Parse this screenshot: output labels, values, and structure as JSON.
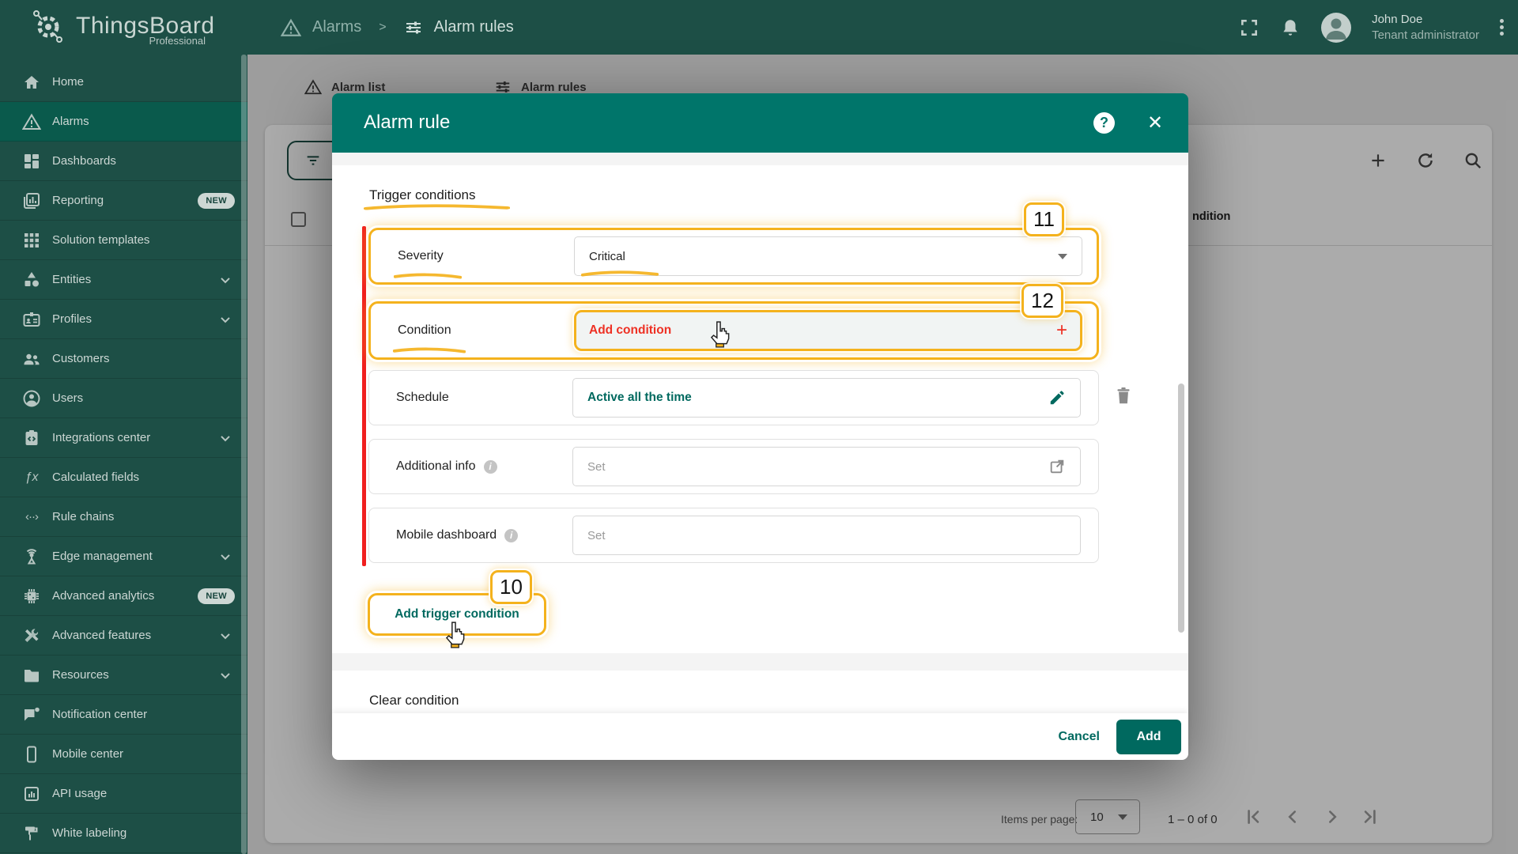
{
  "brand": {
    "name": "ThingsBoard",
    "edition": "Professional"
  },
  "topbar": {
    "breadcrumb": {
      "level1": "Alarms",
      "separator": ">",
      "level2": "Alarm rules"
    },
    "user": {
      "name": "John Doe",
      "role": "Tenant administrator"
    }
  },
  "sidebar": {
    "items": [
      {
        "label": "Home"
      },
      {
        "label": "Alarms",
        "active": true
      },
      {
        "label": "Dashboards"
      },
      {
        "label": "Reporting",
        "badge": "NEW"
      },
      {
        "label": "Solution templates"
      },
      {
        "label": "Entities",
        "expandable": true
      },
      {
        "label": "Profiles",
        "expandable": true
      },
      {
        "label": "Customers"
      },
      {
        "label": "Users"
      },
      {
        "label": "Integrations center",
        "expandable": true
      },
      {
        "label": "Calculated fields"
      },
      {
        "label": "Rule chains"
      },
      {
        "label": "Edge management",
        "expandable": true
      },
      {
        "label": "Advanced analytics",
        "badge": "NEW"
      },
      {
        "label": "Advanced features",
        "expandable": true
      },
      {
        "label": "Resources",
        "expandable": true
      },
      {
        "label": "Notification center"
      },
      {
        "label": "Mobile center"
      },
      {
        "label": "API usage"
      },
      {
        "label": "White labeling"
      }
    ]
  },
  "page": {
    "tabs": [
      {
        "label": "Alarm list"
      },
      {
        "label": "Alarm rules"
      }
    ],
    "table": {
      "header_fragment": "ndition"
    },
    "pagination": {
      "items_per_page_label": "Items per page:",
      "page_size": "10",
      "range": "1 – 0 of 0"
    }
  },
  "dialog": {
    "title": "Alarm rule",
    "trigger_heading": "Trigger conditions",
    "clear_heading": "Clear condition",
    "rows": {
      "severity": {
        "label": "Severity",
        "value": "Critical"
      },
      "condition": {
        "label": "Condition",
        "action": "Add condition"
      },
      "schedule": {
        "label": "Schedule",
        "value": "Active all the time"
      },
      "additional_info": {
        "label": "Additional info",
        "placeholder": "Set"
      },
      "mobile_dashboard": {
        "label": "Mobile dashboard",
        "placeholder": "Set"
      }
    },
    "add_trigger_label": "Add trigger condition",
    "footer": {
      "cancel": "Cancel",
      "add": "Add"
    }
  },
  "annotations": {
    "step_add_trigger": "10",
    "step_severity": "11",
    "step_condition": "12"
  },
  "colors": {
    "brand_bg": "#1d4f46",
    "active_item_bg": "#0a5a4c",
    "dialog_header": "#00756a",
    "primary": "#00695f",
    "alert_red": "#ee3124",
    "annotation_yellow": "#f4b21d"
  }
}
